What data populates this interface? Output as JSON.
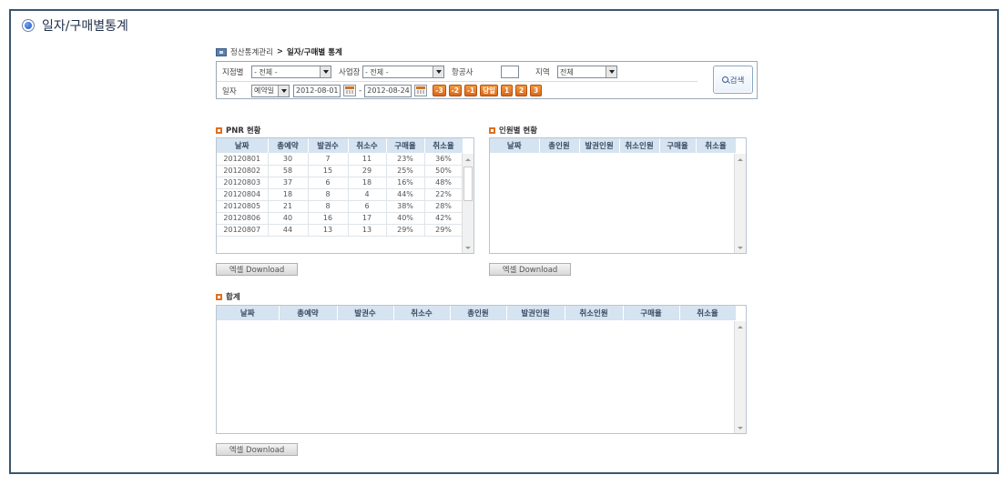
{
  "page": {
    "title": "일자/구매별통계"
  },
  "breadcrumb": {
    "parent": "정산통계관리",
    "separator": ">",
    "current": "일자/구매별 통계"
  },
  "search": {
    "branch_label": "지점별",
    "branch_value": "- 전체 -",
    "office_label": "사업장",
    "office_value": "- 전체 -",
    "airline_label": "항공사",
    "airline_value": "",
    "region_label": "지역",
    "region_value": "전체",
    "date_label": "일자",
    "date_type_value": "예약일",
    "date_from": "2012-08-01",
    "date_sep": "-",
    "date_to": "2012-08-24",
    "quick_buttons": [
      "-3",
      "-2",
      "-1",
      "당일",
      "1",
      "2",
      "3"
    ],
    "search_button": "검색"
  },
  "pnr": {
    "title": "PNR 현황",
    "columns": [
      "날짜",
      "총예약",
      "발권수",
      "취소수",
      "구매율",
      "취소율"
    ],
    "rows": [
      [
        "20120801",
        "30",
        "7",
        "11",
        "23%",
        "36%"
      ],
      [
        "20120802",
        "58",
        "15",
        "29",
        "25%",
        "50%"
      ],
      [
        "20120803",
        "37",
        "6",
        "18",
        "16%",
        "48%"
      ],
      [
        "20120804",
        "18",
        "8",
        "4",
        "44%",
        "22%"
      ],
      [
        "20120805",
        "21",
        "8",
        "6",
        "38%",
        "28%"
      ],
      [
        "20120806",
        "40",
        "16",
        "17",
        "40%",
        "42%"
      ],
      [
        "20120807",
        "44",
        "13",
        "13",
        "29%",
        "29%"
      ]
    ],
    "excel_button": "엑셀 Download"
  },
  "persons": {
    "title": "인원별 현황",
    "columns": [
      "날짜",
      "총인원",
      "발권인원",
      "취소인원",
      "구매율",
      "취소율"
    ],
    "excel_button": "엑셀 Download"
  },
  "total": {
    "title": "합계",
    "columns": [
      "날짜",
      "총예약",
      "발권수",
      "취소수",
      "총인원",
      "발권인원",
      "취소인원",
      "구매율",
      "취소율"
    ],
    "excel_button": "엑셀 Download"
  }
}
